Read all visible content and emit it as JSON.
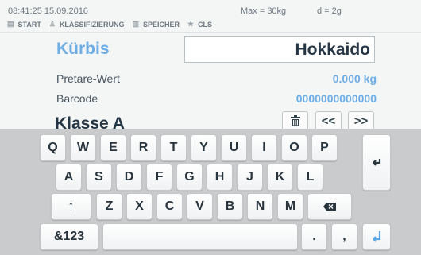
{
  "status": {
    "time": "08:41:25 15.09.2016",
    "max": "Max = 30kg",
    "d": "d = 2g"
  },
  "nav": {
    "items": [
      "START",
      "KLASSIFIZIERUNG",
      "SPEICHER",
      "CLS"
    ]
  },
  "form": {
    "name": "Kürbis",
    "variety": "Hokkaido",
    "pretare_label": "Pretare-Wert",
    "pretare_value": "0.000 kg",
    "barcode_label": "Barcode",
    "barcode_value": "0000000000000",
    "klasse": "Klasse A"
  },
  "buttons": {
    "trash_icon": "trash-icon",
    "prev_label": "<<",
    "next_label": ">>"
  },
  "keyboard": {
    "rows": [
      [
        "Q",
        "W",
        "E",
        "R",
        "T",
        "Y",
        "U",
        "I",
        "O",
        "P"
      ],
      [
        "A",
        "S",
        "D",
        "F",
        "G",
        "H",
        "J",
        "K",
        "L"
      ],
      [
        "Z",
        "X",
        "C",
        "V",
        "B",
        "N",
        "M"
      ]
    ],
    "numeric_label": "&123",
    "dot_label": ".",
    "comma_label": ","
  }
}
